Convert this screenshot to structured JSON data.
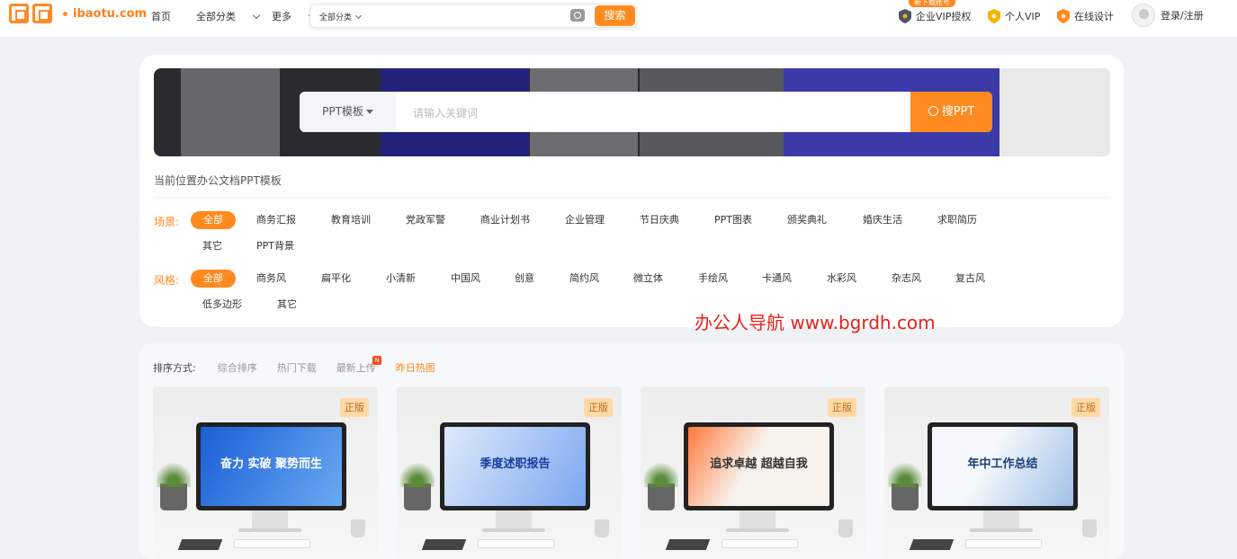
{
  "header": {
    "logo_text": "ibaotu.com",
    "nav": [
      {
        "label": "首页",
        "has_chevron": false
      },
      {
        "label": "全部分类",
        "has_chevron": true
      },
      {
        "label": "更多",
        "has_chevron": true
      }
    ],
    "search": {
      "category": "全部分类",
      "button": "搜索",
      "icon": "camera-icon"
    },
    "promo_tag": "新下载账号",
    "right": [
      {
        "label": "企业VIP授权",
        "icon": "shield-icon",
        "color": "#4a5568"
      },
      {
        "label": "个人VIP",
        "icon": "shield-icon",
        "color": "#f5b400"
      },
      {
        "label": "在线设计",
        "icon": "shield-icon",
        "color": "#ff8a1f"
      }
    ],
    "login": "登录/注册"
  },
  "banner_search": {
    "category": "PPT模板",
    "placeholder": "请输入关键词",
    "button": "搜PPT"
  },
  "breadcrumb": "当前位置办公文档PPT模板",
  "filters": {
    "scene": {
      "label": "场景:",
      "options": [
        "全部",
        "商务汇报",
        "教育培训",
        "党政军警",
        "商业计划书",
        "企业管理",
        "节日庆典",
        "PPT图表",
        "颁奖典礼",
        "婚庆生活",
        "求职简历",
        "其它",
        "PPT背景"
      ],
      "active": "全部"
    },
    "style": {
      "label": "风格:",
      "options": [
        "全部",
        "商务风",
        "扁平化",
        "小清新",
        "中国风",
        "创意",
        "简约风",
        "微立体",
        "手绘风",
        "卡通风",
        "水彩风",
        "杂志风",
        "复古风",
        "低多边形",
        "其它"
      ],
      "active": "全部"
    }
  },
  "watermark": "办公人导航 www.bgrdh.com",
  "sort": {
    "label": "排序方式:",
    "options": [
      "综合排序",
      "热门下载",
      "最新上传",
      "昨日热图"
    ],
    "active": "昨日热图",
    "new_badge": "N"
  },
  "cards": [
    {
      "badge": "正版",
      "title": "奋力 实破 聚势而生",
      "screen_colors": [
        "#1a5fd6",
        "#6aa9f2"
      ]
    },
    {
      "badge": "正版",
      "title": "季度述职报告",
      "screen_colors": [
        "#dfe9fb",
        "#7aa7f0"
      ]
    },
    {
      "badge": "正版",
      "title": "追求卓越 超越自我",
      "screen_colors": [
        "#f7f2ec",
        "#ff7a3c"
      ]
    },
    {
      "badge": "正版",
      "title": "年中工作总结",
      "screen_colors": [
        "#f4f7fb",
        "#9fc0e8"
      ]
    }
  ],
  "colors": {
    "accent": "#ff8a1f",
    "watermark": "#e8201a"
  }
}
